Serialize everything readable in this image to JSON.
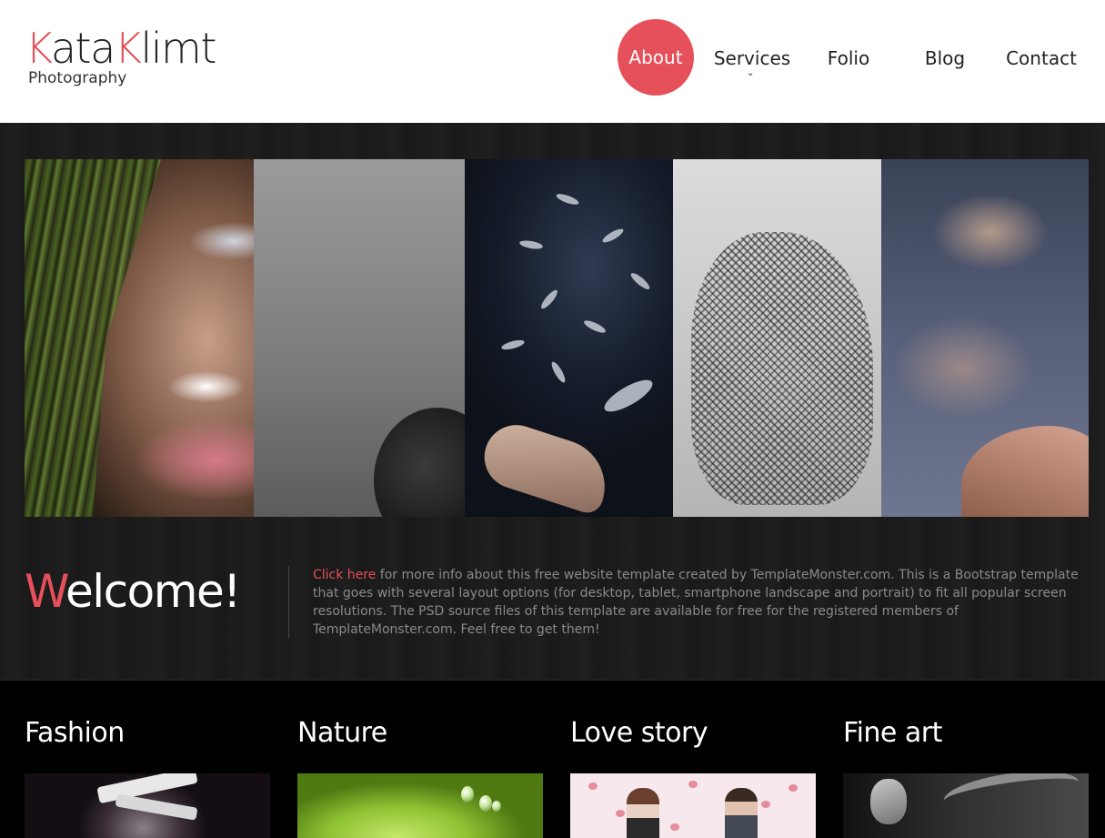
{
  "brand": {
    "title_accent_1": "K",
    "title_part_1": "ata",
    "title_accent_2": "K",
    "title_part_2": "limt",
    "subtitle": "Photography",
    "accent_color": "#e6505a"
  },
  "nav": {
    "about": "About",
    "services": "Services",
    "folio": "Folio",
    "blog": "Blog",
    "contact": "Contact",
    "active": "About",
    "services_indicator": "⌄"
  },
  "hero": {
    "welcome_accent": "W",
    "welcome_rest": "elcome!",
    "link_text": "Click here",
    "body_text": " for more info about this free website template created by TemplateMonster.com. This is a Bootstrap template that goes with several layout options (for desktop, tablet, smartphone landscape and portrait) to fit all popular screen resolutions. The PSD source files of this template are available for free for the registered members of TemplateMonster.com. Feel free to get them!"
  },
  "categories": [
    {
      "title": "Fashion"
    },
    {
      "title": "Nature"
    },
    {
      "title": "Love story"
    },
    {
      "title": "Fine art"
    }
  ]
}
